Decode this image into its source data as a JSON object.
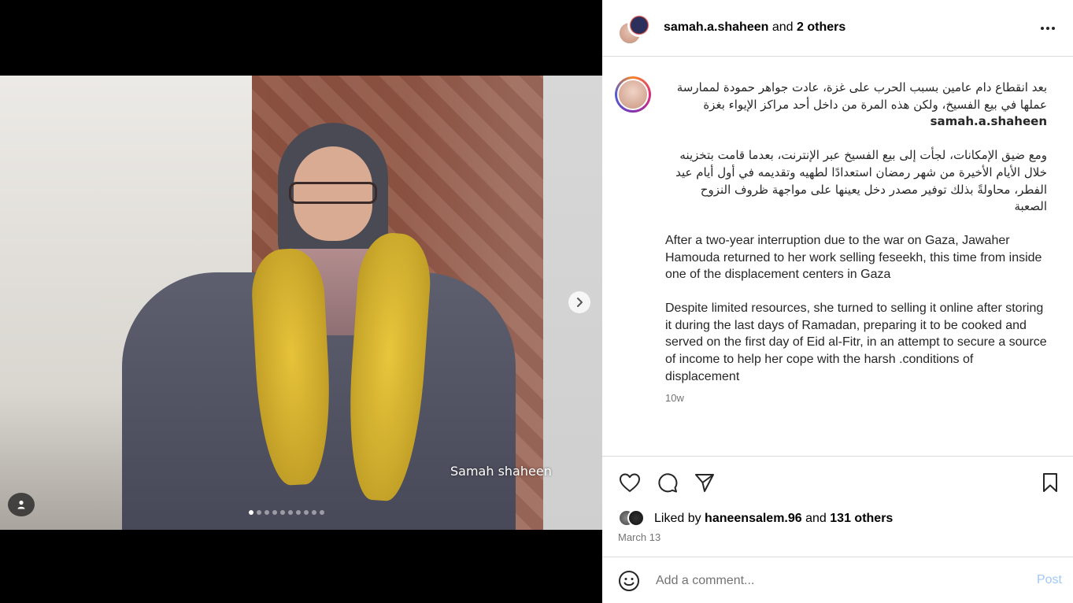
{
  "media": {
    "watermark": "Samah shaheen",
    "carousel_count": 10,
    "carousel_active_index": 0,
    "next_icon": "chevron-right-icon",
    "tag_icon": "user-tag-icon"
  },
  "header": {
    "username": "samah.a.shaheen",
    "and_others": "and",
    "others_count": "2 others",
    "more_icon": "more-horizontal-icon"
  },
  "caption": {
    "username": "samah.a.shaheen",
    "para1_ar": "بعد انقطاع دام عامين بسبب الحرب على غزة، عادت جواهر حمودة لممارسة عملها في بيع الفسيخ، ولكن هذه المرة من داخل أحد مراكز الإيواء بغزة",
    "para2_ar": "ومع ضيق الإمكانات، لجأت إلى بيع الفسيخ عبر الإنترنت، بعدما قامت بتخزينه خلال الأيام الأخيرة من شهر رمضان استعدادًا لطهيه وتقديمه في أول أيام عيد الفطر، محاولةً بذلك توفير مصدر دخل يعينها على مواجهة ظروف النزوح الصعبة",
    "para3_en": "After a two-year interruption due to the war on Gaza, Jawaher Hamouda returned to her work selling feseekh, this time from inside one of the displacement centers in Gaza",
    "para4_en": "Despite limited resources, she turned to selling it online after storing it during the last days of Ramadan, preparing it to be cooked and served on the first day of Eid al-Fitr, in an attempt to secure a source of income to help her cope with the harsh .conditions of displacement",
    "time_ago": "10w"
  },
  "actions": {
    "like_icon": "heart-icon",
    "comment_icon": "comment-icon",
    "share_icon": "send-icon",
    "save_icon": "bookmark-icon",
    "liked_by_prefix": "Liked by",
    "liked_by_user": "haneensalem.96",
    "and": "and",
    "others": "131 others",
    "date": "March 13"
  },
  "comment": {
    "placeholder": "Add a comment...",
    "post_label": "Post",
    "emoji_icon": "smiley-icon"
  },
  "colors": {
    "accent_link": "#0095f6",
    "post_disabled": "#a0c8f5",
    "muted": "#737373",
    "border": "#dbdbdb"
  }
}
